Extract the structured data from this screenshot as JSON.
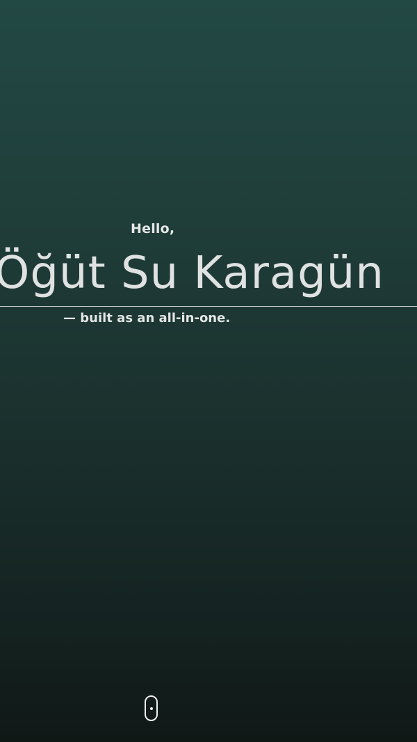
{
  "hero": {
    "greeting": "Hello,",
    "name": "Öğüt Su Karagün",
    "tagline": "— built as an all-in-one."
  },
  "scroll": {
    "icon": "mouse-scroll-icon"
  },
  "colors": {
    "background_top": "#234945",
    "background_bottom": "#101816",
    "text": "#e3e6e5",
    "underline": "#d9dcdb"
  }
}
